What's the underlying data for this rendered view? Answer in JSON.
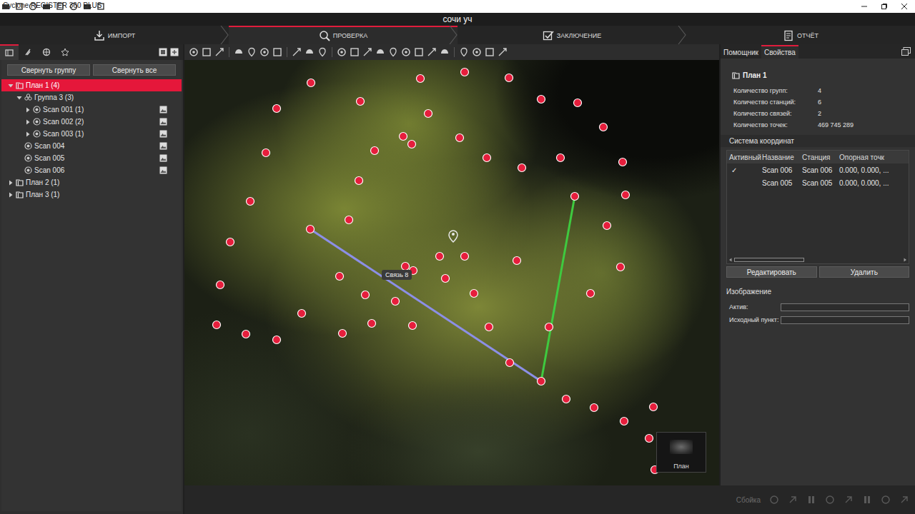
{
  "window": {
    "title": "Cyclone REGISTER 360 PLUS"
  },
  "project": {
    "name": "сочи уч"
  },
  "workflow_tabs": [
    {
      "label": "ИМПОРТ",
      "selected": false
    },
    {
      "label": "ПРОВЕРКА",
      "selected": true
    },
    {
      "label": "ЗАКЛЮЧЕНИЕ",
      "selected": false
    },
    {
      "label": "ОТЧЁТ",
      "selected": false
    }
  ],
  "left_panel": {
    "tabs": [
      {
        "selected": true
      },
      {
        "selected": false
      },
      {
        "selected": false
      },
      {
        "selected": false
      }
    ],
    "buttons": [
      "Свернуть группу",
      "Свернуть все"
    ],
    "tree": [
      {
        "label": "План 1 (4)",
        "kind": "plan",
        "depth": 0,
        "has_children": true,
        "expanded": true,
        "selected": true,
        "image": false
      },
      {
        "label": "Группа 3 (3)",
        "kind": "group",
        "depth": 1,
        "has_children": true,
        "expanded": true,
        "selected": false,
        "image": false
      },
      {
        "label": "Scan 001 (1)",
        "kind": "scan",
        "depth": 2,
        "has_children": true,
        "expanded": false,
        "selected": false,
        "image": true
      },
      {
        "label": "Scan 002 (2)",
        "kind": "scan",
        "depth": 2,
        "has_children": true,
        "expanded": false,
        "selected": false,
        "image": true
      },
      {
        "label": "Scan 003 (1)",
        "kind": "scan",
        "depth": 2,
        "has_children": true,
        "expanded": false,
        "selected": false,
        "image": true
      },
      {
        "label": "Scan 004",
        "kind": "scan",
        "depth": 1,
        "has_children": false,
        "expanded": false,
        "selected": false,
        "image": true
      },
      {
        "label": "Scan 005",
        "kind": "scan",
        "depth": 1,
        "has_children": false,
        "expanded": false,
        "selected": false,
        "image": true
      },
      {
        "label": "Scan 006",
        "kind": "scan",
        "depth": 1,
        "has_children": false,
        "expanded": false,
        "selected": false,
        "image": true
      },
      {
        "label": "План 2 (1)",
        "kind": "plan",
        "depth": 0,
        "has_children": true,
        "expanded": false,
        "selected": false,
        "image": false
      },
      {
        "label": "План 3 (1)",
        "kind": "plan",
        "depth": 0,
        "has_children": true,
        "expanded": false,
        "selected": false,
        "image": false
      }
    ]
  },
  "viewport": {
    "links": [
      {
        "label": "Связь 8",
        "color": "#8c8fe6"
      },
      {
        "label": null,
        "color": "#3fc93f"
      }
    ],
    "minimap": {
      "label": "План"
    }
  },
  "right_panel": {
    "tabs": [
      {
        "label": "Помощник",
        "selected": false
      },
      {
        "label": "Свойства",
        "selected": true
      }
    ],
    "title": "План 1",
    "properties": [
      {
        "label": "Количество групп:",
        "value": "4"
      },
      {
        "label": "Количество станций:",
        "value": "6"
      },
      {
        "label": "Количество связей:",
        "value": "2"
      },
      {
        "label": "Количество точек:",
        "value": "469 745 289"
      }
    ],
    "coordinate_system": {
      "title": "Система координат",
      "check_glyph": "✓",
      "columns": [
        "Активный",
        "Название",
        "Станция",
        "Опорная точк"
      ],
      "rows": [
        {
          "active": true,
          "name": "Scan 006",
          "station": "Scan 006",
          "reference": "0.000, 0.000, ..."
        },
        {
          "active": false,
          "name": "Scan 005",
          "station": "Scan 005",
          "reference": "0.000, 0.000, ..."
        }
      ],
      "buttons": [
        "Редактировать",
        "Удалить"
      ]
    },
    "image": {
      "title": "Изображение",
      "fields": [
        {
          "label": "Актив:",
          "value": ""
        },
        {
          "label": "Исходный пункт:",
          "value": ""
        }
      ]
    }
  },
  "status_bar": {
    "label": "Сбойка"
  }
}
